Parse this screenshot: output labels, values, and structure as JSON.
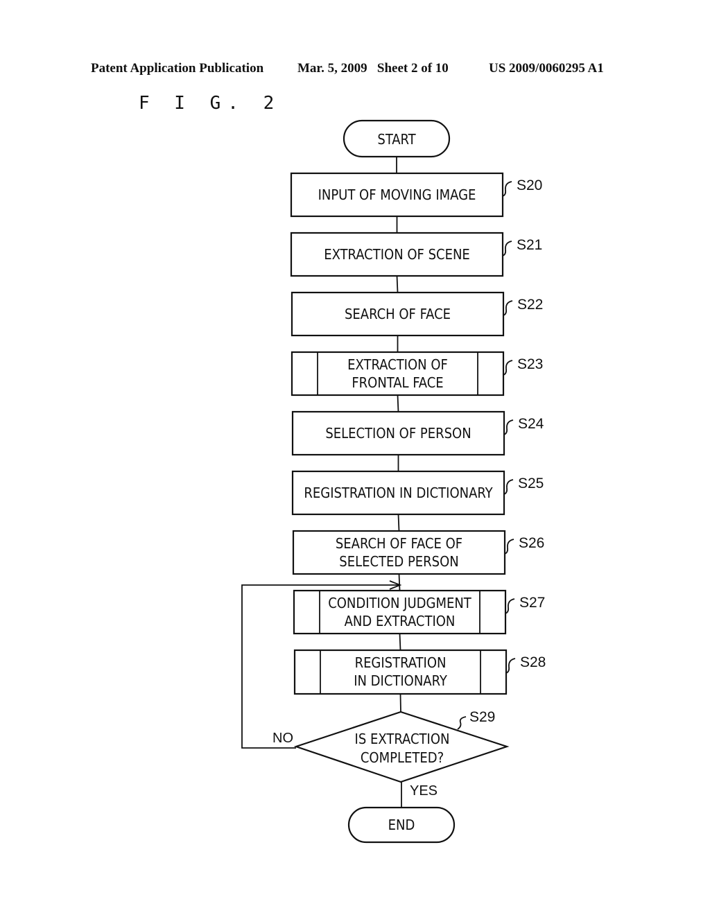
{
  "header": {
    "publication_type": "Patent Application Publication",
    "date_sheet": "Mar. 5, 2009   Sheet 2 of 10",
    "publication_number": "US 2009/0060295 A1"
  },
  "figure_label": "F I G. 2",
  "flowchart": {
    "start": "START",
    "end": "END",
    "steps": [
      {
        "id": "S20",
        "type": "process",
        "lines": [
          "INPUT OF MOVING IMAGE"
        ]
      },
      {
        "id": "S21",
        "type": "process",
        "lines": [
          "EXTRACTION OF SCENE"
        ]
      },
      {
        "id": "S22",
        "type": "process",
        "lines": [
          "SEARCH OF FACE"
        ]
      },
      {
        "id": "S23",
        "type": "subroutine",
        "lines": [
          "EXTRACTION OF",
          "FRONTAL FACE"
        ]
      },
      {
        "id": "S24",
        "type": "process",
        "lines": [
          "SELECTION OF PERSON"
        ]
      },
      {
        "id": "S25",
        "type": "process",
        "lines": [
          "REGISTRATION IN DICTIONARY"
        ]
      },
      {
        "id": "S26",
        "type": "process",
        "lines": [
          "SEARCH OF FACE OF",
          "SELECTED PERSON"
        ]
      },
      {
        "id": "S27",
        "type": "subroutine",
        "lines": [
          "CONDITION JUDGMENT",
          "AND EXTRACTION"
        ]
      },
      {
        "id": "S28",
        "type": "subroutine",
        "lines": [
          "REGISTRATION",
          "IN DICTIONARY"
        ]
      }
    ],
    "decision": {
      "id": "S29",
      "lines": [
        "IS EXTRACTION",
        "COMPLETED?"
      ],
      "no_label": "NO",
      "yes_label": "YES",
      "no_target": "S27",
      "yes_target": "END"
    }
  }
}
